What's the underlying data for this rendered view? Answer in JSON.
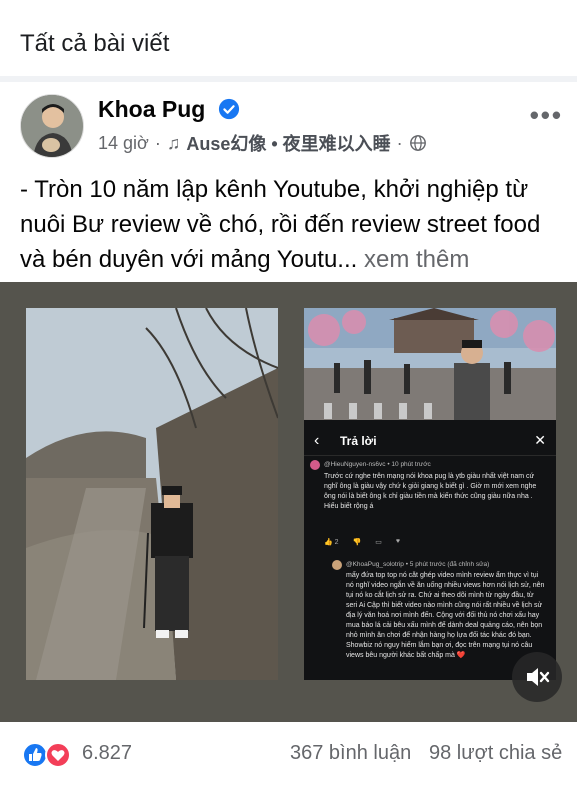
{
  "page": {
    "section_title": "Tất cả bài viết"
  },
  "post": {
    "author": "Khoa Pug",
    "time": "14 giờ",
    "music_label": "Ause幻像 • 夜里难以入睡",
    "text": "- Tròn 10 năm lập kênh Youtube, khởi nghiệp từ nuôi Bư review về chó, rồi đến review street food và bén duyên với mảng Youtu...",
    "see_more": "xem thêm",
    "stats": {
      "reactions": "6.827",
      "comments": "367 bình luận",
      "shares": "98 lượt chia sẻ"
    }
  },
  "embedded_screenshot": {
    "panel_title": "Trả lời",
    "comment1": {
      "author": "@HieuNguyen-ns6vc • 10 phút trước",
      "text": "Trước cứ nghe trên mạng nói khoa pug là ytb giàu nhất việt nam cứ nghĩ ông là giàu vậy chứ k giỏi giang k biết gì . Giờ m mới xem nghe ông nói là biết ông k chỉ giàu tiền mà kiến thức cũng giàu nữa nha . Hiểu biết rộng á",
      "likes": "2"
    },
    "comment2": {
      "author": "@KhoaPug_solotrip • 5 phút trước (đã chỉnh sửa)",
      "text": "mấy đứa top top nó cắt ghép video mình review ẩm thực vì tụi nó nghĩ video ngắn về ăn uống nhiều views hơn nói lịch sử, nên tụi nó ko cắt lịch sử ra. Chứ ai theo dõi mình từ ngày đầu, từ seri Ai Cập thì biết video nào mình cũng nói rất nhiều về lịch sử địa lý văn hoá nơi mình đến. Cộng với đối thủ nó chơi xấu hay mua báo lá cải bêu xấu mình để dành deal quảng cáo, nên bọn nhỏ mình ăn chơi để nhận hàng họ lựa đối tác khác đó bạn. Showbiz nó nguy hiểm lắm bạn ơi, đọc trên mạng tụi nó câu views bêu người khác bất chấp mà ❤️"
    }
  },
  "colors": {
    "like_blue": "#1877f2",
    "love_red": "#f33e58",
    "verified_blue": "#1877f2",
    "muted_text": "#65676b"
  },
  "icons": {
    "verified": "verified-badge-icon",
    "music": "music-note-icon",
    "globe": "globe-icon",
    "more": "more-options-icon",
    "mute": "speaker-muted-icon",
    "like": "like-reaction-icon",
    "love": "love-reaction-icon"
  }
}
